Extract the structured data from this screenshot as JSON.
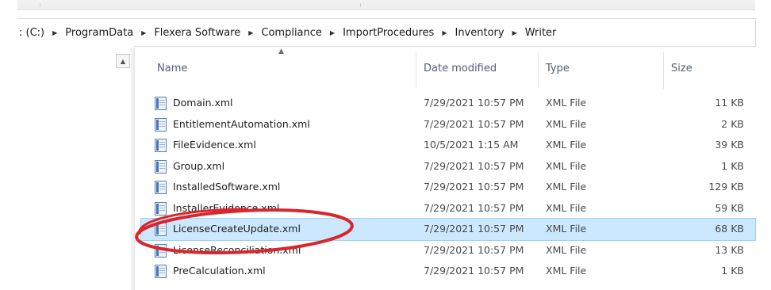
{
  "address_bar": {
    "crumbs": [
      ": (C:)",
      "ProgramData",
      "Flexera Software",
      "Compliance",
      "ImportProcedures",
      "Inventory",
      "Writer"
    ],
    "separator": "▶"
  },
  "columns": {
    "name": "Name",
    "date_modified": "Date modified",
    "type": "Type",
    "size": "Size"
  },
  "files": [
    {
      "name": "Domain.xml",
      "date": "7/29/2021 10:57 PM",
      "type": "XML File",
      "size": "11 KB"
    },
    {
      "name": "EntitlementAutomation.xml",
      "date": "7/29/2021 10:57 PM",
      "type": "XML File",
      "size": "2 KB"
    },
    {
      "name": "FileEvidence.xml",
      "date": "10/5/2021 1:15 AM",
      "type": "XML File",
      "size": "39 KB"
    },
    {
      "name": "Group.xml",
      "date": "7/29/2021 10:57 PM",
      "type": "XML File",
      "size": "1 KB"
    },
    {
      "name": "InstalledSoftware.xml",
      "date": "7/29/2021 10:57 PM",
      "type": "XML File",
      "size": "129 KB"
    },
    {
      "name": "InstallerEvidence.xml",
      "date": "7/29/2021 10:57 PM",
      "type": "XML File",
      "size": "59 KB"
    },
    {
      "name": "LicenseCreateUpdate.xml",
      "date": "7/29/2021 10:57 PM",
      "type": "XML File",
      "size": "68 KB",
      "selected": true
    },
    {
      "name": "LicenseReconciliation.xml",
      "date": "7/29/2021 10:57 PM",
      "type": "XML File",
      "size": "13 KB"
    },
    {
      "name": "PreCalculation.xml",
      "date": "7/29/2021 10:57 PM",
      "type": "XML File",
      "size": "1 KB"
    }
  ],
  "icons": {
    "file": "xml-file-icon",
    "sort": "sort-ascending-icon",
    "scroll_up": "scroll-up-icon",
    "breadcrumb_separator": "chevron-right-icon"
  },
  "colors": {
    "selection_bg": "#cce8ff",
    "annotation": "#d9262d",
    "header_text": "#4c607a"
  }
}
